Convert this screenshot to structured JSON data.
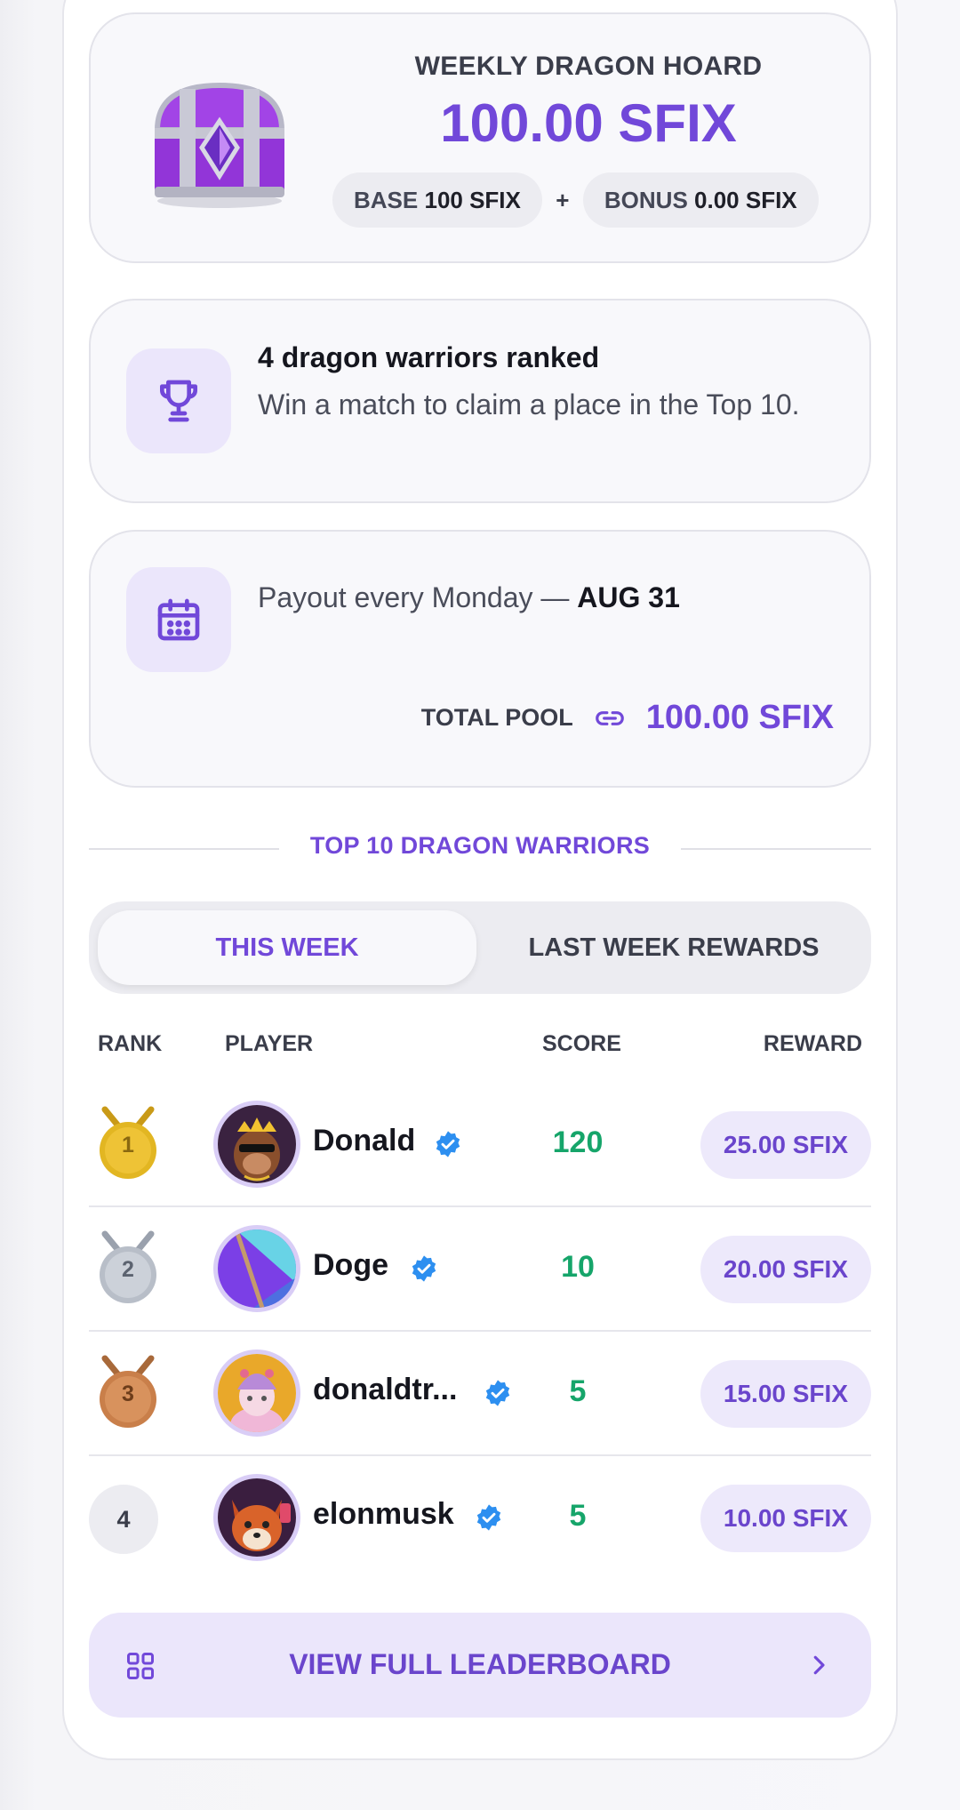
{
  "hoard": {
    "title": "WEEKLY DRAGON HOARD",
    "amount": "100.00 SFIX",
    "base_label": "BASE",
    "base_value": "100 SFIX",
    "plus": "+",
    "bonus_label": "BONUS",
    "bonus_value": "0.00 SFIX",
    "icon": "treasure-chest-icon"
  },
  "ranked": {
    "title": "4 dragon warriors ranked",
    "text": "Win a match to claim a place in the Top 10.",
    "icon": "trophy-icon"
  },
  "payout": {
    "text": "Payout every Monday —",
    "date": "AUG 31",
    "pool_label": "TOTAL POOL",
    "pool_amount": "100.00 SFIX",
    "icon": "calendar-icon",
    "link_icon": "link-icon"
  },
  "section_title": "TOP 10 DRAGON WARRIORS",
  "tabs": {
    "active": "THIS WEEK",
    "inactive": "LAST WEEK REWARDS"
  },
  "table": {
    "headers": {
      "rank": "RANK",
      "player": "PLAYER",
      "score": "SCORE",
      "reward": "REWARD"
    },
    "rows": [
      {
        "rank": "1",
        "name": "Donald",
        "score": "120",
        "reward": "25.00 SFIX",
        "medal": "gold-medal-icon"
      },
      {
        "rank": "2",
        "name": "Doge",
        "score": "10",
        "reward": "20.00 SFIX",
        "medal": "silver-medal-icon"
      },
      {
        "rank": "3",
        "name": "donaldtr...",
        "score": "5",
        "reward": "15.00 SFIX",
        "medal": "bronze-medal-icon"
      },
      {
        "rank": "4",
        "name": "elonmusk",
        "score": "5",
        "reward": "10.00 SFIX",
        "medal": ""
      }
    ]
  },
  "cta": {
    "label": "VIEW FULL LEADERBOARD",
    "icon": "grid-icon",
    "chevron": "chevron-right-icon"
  },
  "colors": {
    "accent": "#7148d9",
    "score": "#16a56a",
    "verified": "#2d8ff0"
  }
}
